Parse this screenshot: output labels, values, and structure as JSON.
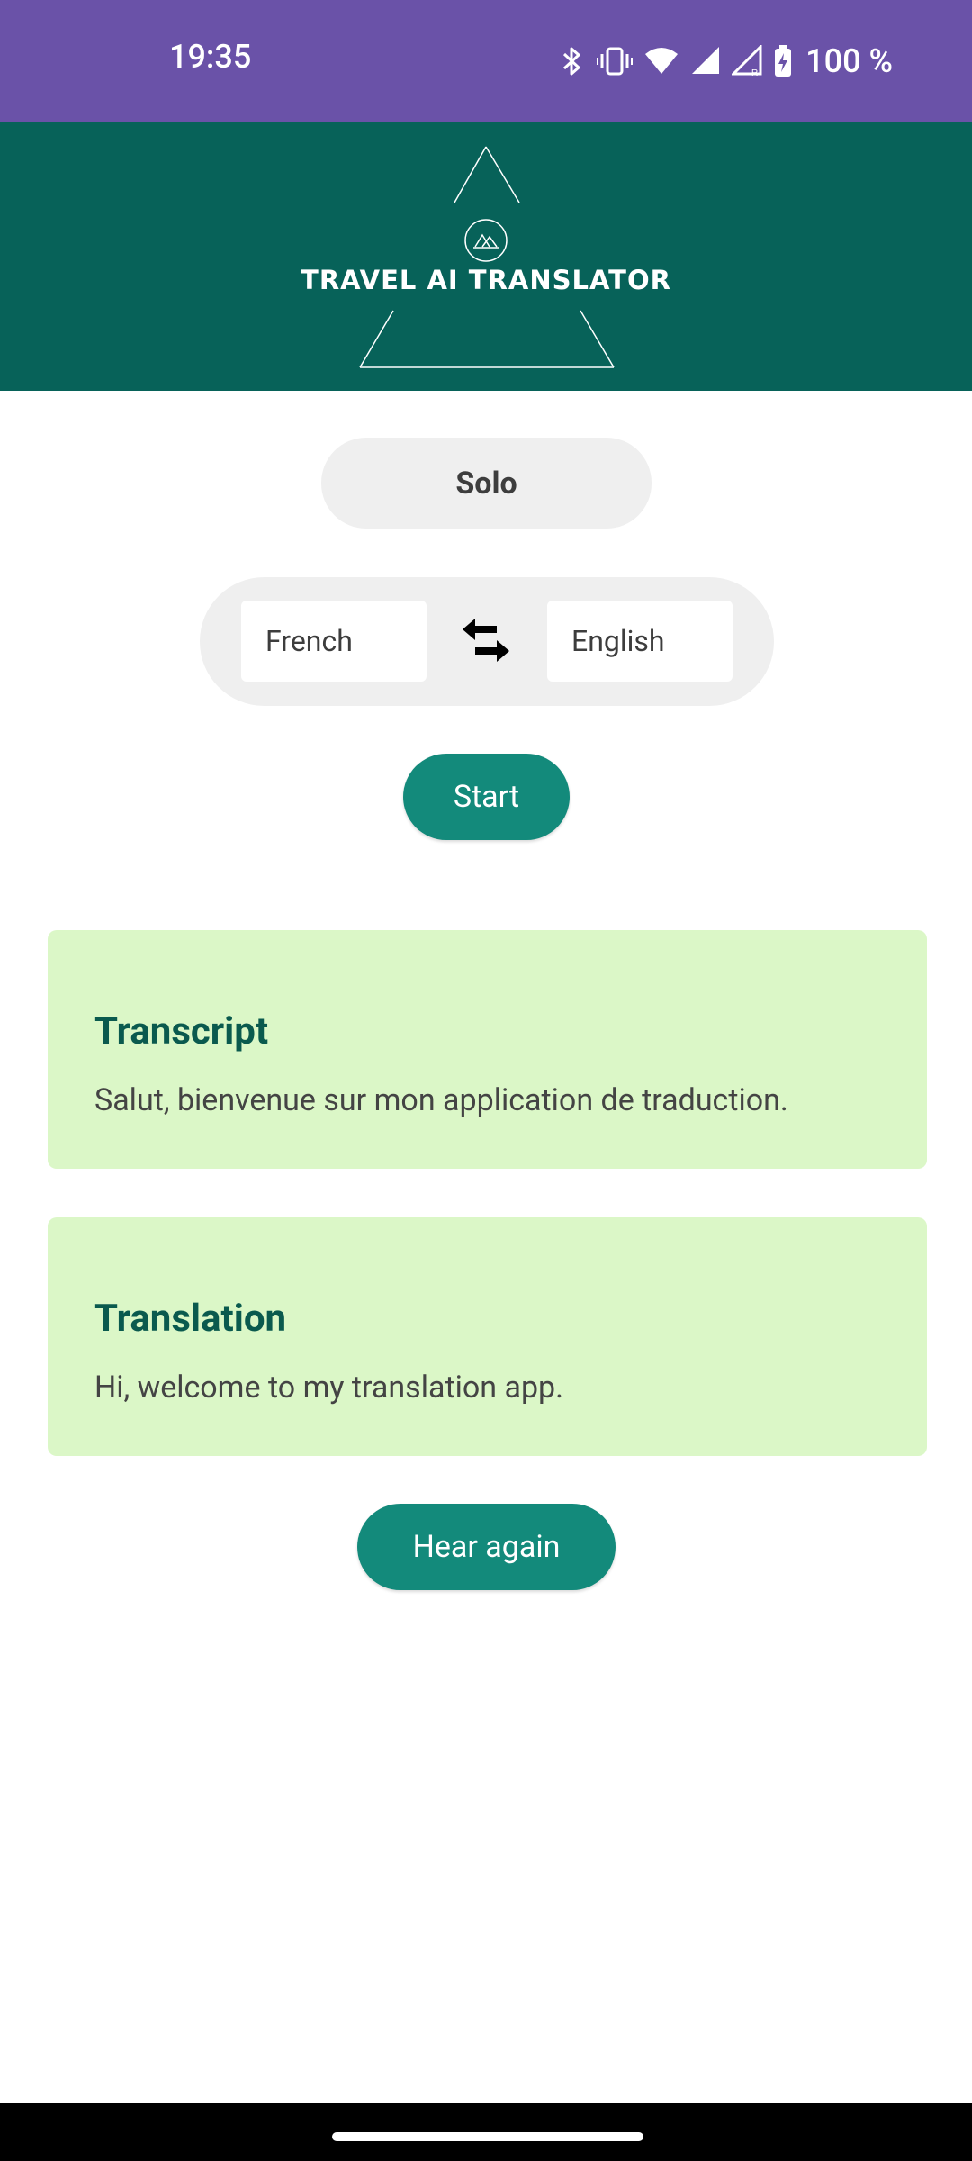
{
  "status_bar": {
    "time": "19:35",
    "battery": "100 %",
    "icons": [
      "bluetooth-icon",
      "vibrate-icon",
      "wifi-icon",
      "cell-signal-icon",
      "cell-signal-roaming-icon",
      "battery-charging-icon"
    ]
  },
  "header": {
    "app_title": "TRAVEL AI TRANSLATOR",
    "logo_icon": "mountain-triangle-logo"
  },
  "mode": {
    "label": "Solo"
  },
  "languages": {
    "source": "French",
    "target": "English",
    "swap_icon": "swap-arrows-icon"
  },
  "actions": {
    "start_label": "Start",
    "hear_again_label": "Hear again"
  },
  "transcript": {
    "title": "Transcript",
    "text": "Salut, bienvenue sur mon application de traduction."
  },
  "translation": {
    "title": "Translation",
    "text": "Hi, welcome to my translation app."
  },
  "colors": {
    "status_bar": "#6a52a8",
    "header": "#076259",
    "accent_button": "#138a7b",
    "card_bg": "#dbf7c7",
    "card_title": "#0a5a4e",
    "pill_bg": "#efefef"
  }
}
